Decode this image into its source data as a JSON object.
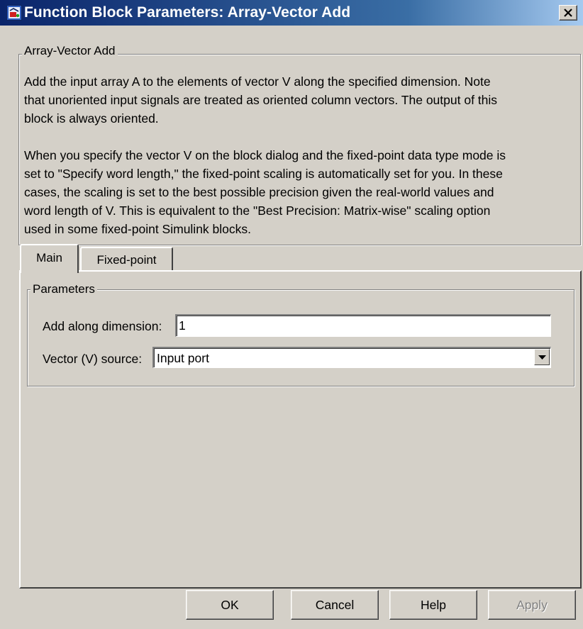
{
  "window": {
    "title": "Function Block Parameters: Array-Vector Add"
  },
  "icons": {
    "app": "simulink-block-icon",
    "close": "close-icon",
    "dropdown": "chevron-down-icon"
  },
  "description": {
    "group_title": "Array-Vector Add",
    "lines": [
      "Add the input array A to the elements of vector V along the specified dimension.  Note",
      "that unoriented input signals are treated as oriented column vectors. The output of this",
      "block is always oriented.",
      "",
      "When you specify the vector V on the block dialog and the fixed-point data type mode is",
      "set to \"Specify word length,\" the fixed-point scaling is automatically set for you. In these",
      "cases, the scaling is set to the best possible precision given the real-world values and",
      "word length of V. This is equivalent to the \"Best Precision: Matrix-wise\" scaling option",
      "used in some fixed-point Simulink blocks."
    ]
  },
  "tabs": [
    {
      "label": "Main",
      "active": true
    },
    {
      "label": "Fixed-point",
      "active": false
    }
  ],
  "parameters": {
    "group_title": "Parameters",
    "add_along_dimension": {
      "label": "Add along dimension:",
      "value": "1"
    },
    "vector_source": {
      "label": "Vector (V) source:",
      "value": "Input port"
    }
  },
  "buttons": {
    "ok": "OK",
    "cancel": "Cancel",
    "help": "Help",
    "apply": "Apply"
  },
  "colors": {
    "dialog_bg": "#d4d0c8",
    "titlebar_start": "#0a246a",
    "titlebar_end": "#a6caf0",
    "disabled_text": "#808080"
  }
}
